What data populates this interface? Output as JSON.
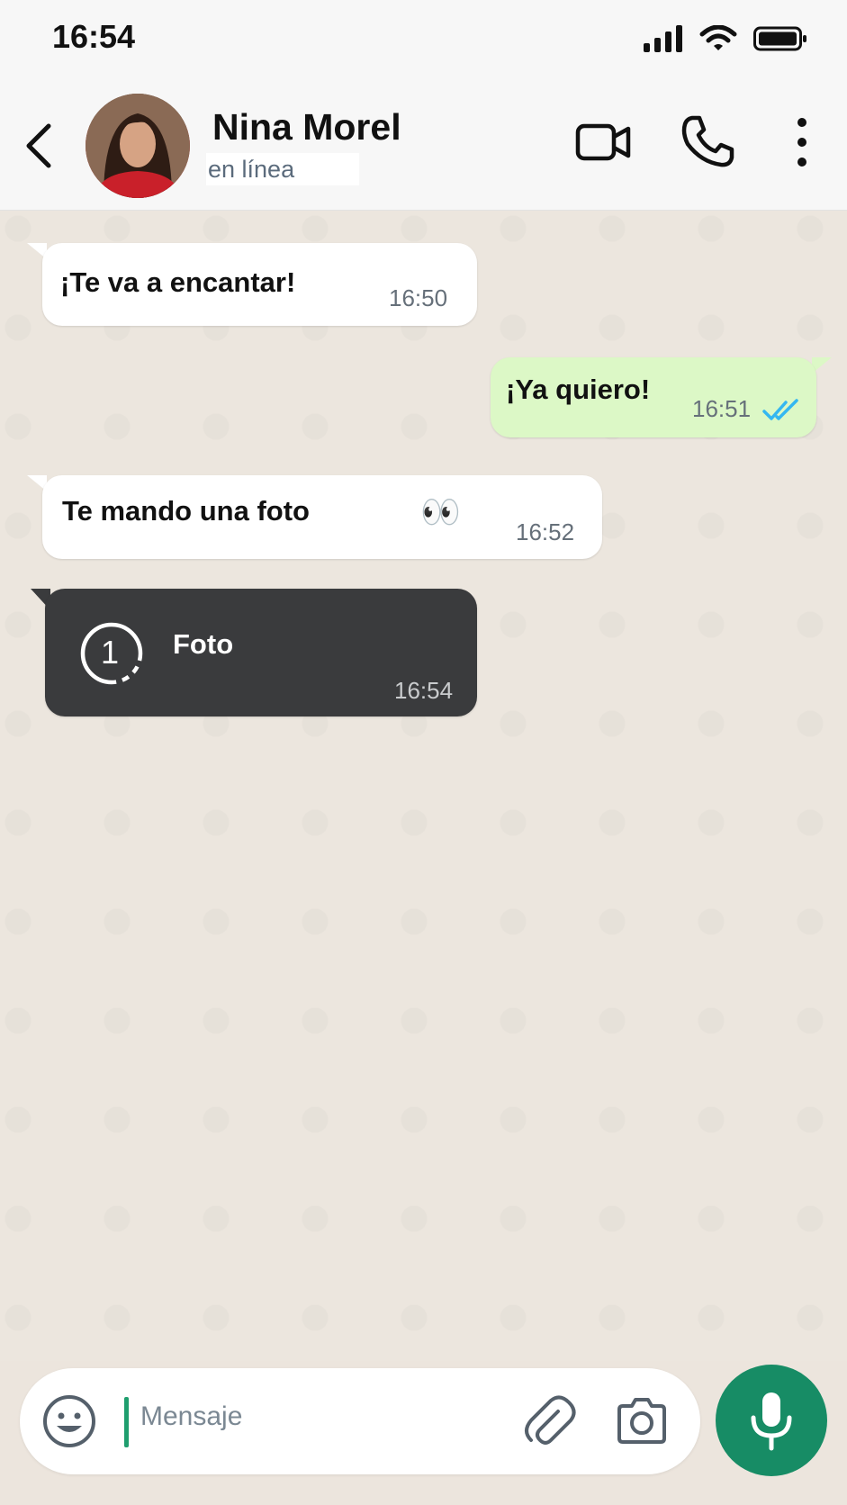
{
  "status_bar": {
    "time": "16:54"
  },
  "header": {
    "contact_name": "Nina Morel",
    "contact_status": "en línea"
  },
  "messages": [
    {
      "direction": "in",
      "text": "¡Te va a encantar!",
      "time": "16:50"
    },
    {
      "direction": "out",
      "text": "¡Ya quiero!",
      "time": "16:51",
      "read": true
    },
    {
      "direction": "in",
      "text": "Te mando una foto",
      "emoji": "👀",
      "time": "16:52"
    },
    {
      "direction": "in",
      "type": "view-once-photo",
      "view_once_count": "1",
      "text": "Foto",
      "time": "16:54"
    }
  ],
  "composer": {
    "placeholder": "Mensaje"
  },
  "colors": {
    "accent": "#178c65",
    "outgoing_bubble": "#dcf8c6",
    "incoming_bubble": "#ffffff",
    "view_once_bubble": "#3a3b3d",
    "read_ticks": "#34b7f1",
    "chat_background": "#ece6de"
  },
  "icons": [
    "back-arrow-icon",
    "video-call-icon",
    "phone-icon",
    "more-options-icon",
    "double-check-icon",
    "view-once-icon",
    "emoji-icon",
    "attach-icon",
    "camera-icon",
    "microphone-icon"
  ]
}
